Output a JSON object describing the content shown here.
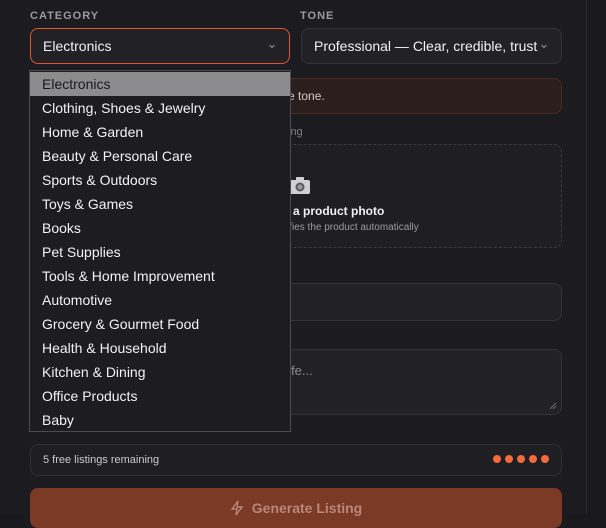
{
  "colors": {
    "accent": "#e2552f",
    "dots": "#f26a3d",
    "bg": "#1c1c20"
  },
  "category": {
    "label": "CATEGORY",
    "value": "Electronics",
    "options": [
      "Electronics",
      "Clothing, Shoes & Jewelry",
      "Home & Garden",
      "Beauty & Personal Care",
      "Sports & Outdoors",
      "Toys & Games",
      "Books",
      "Pet Supplies",
      "Tools & Home Improvement",
      "Automotive",
      "Grocery & Gourmet Food",
      "Health & Household",
      "Kitchen & Dining",
      "Office Products",
      "Baby"
    ]
  },
  "tone": {
    "label": "TONE",
    "value": "Professional — Clear, credible, trust"
  },
  "notice": {
    "visible_text": "e tone."
  },
  "photo": {
    "label_fragment": "ing",
    "title_fragment": "a product photo",
    "subtitle_fragment": "ifies the product automatically",
    "icon": "camera-icon"
  },
  "features": {
    "placeholder_fragment": "fe..."
  },
  "credits": {
    "text": "5 free listings remaining",
    "dots": 5
  },
  "generate": {
    "label": "Generate Listing",
    "icon": "lightning-icon"
  }
}
